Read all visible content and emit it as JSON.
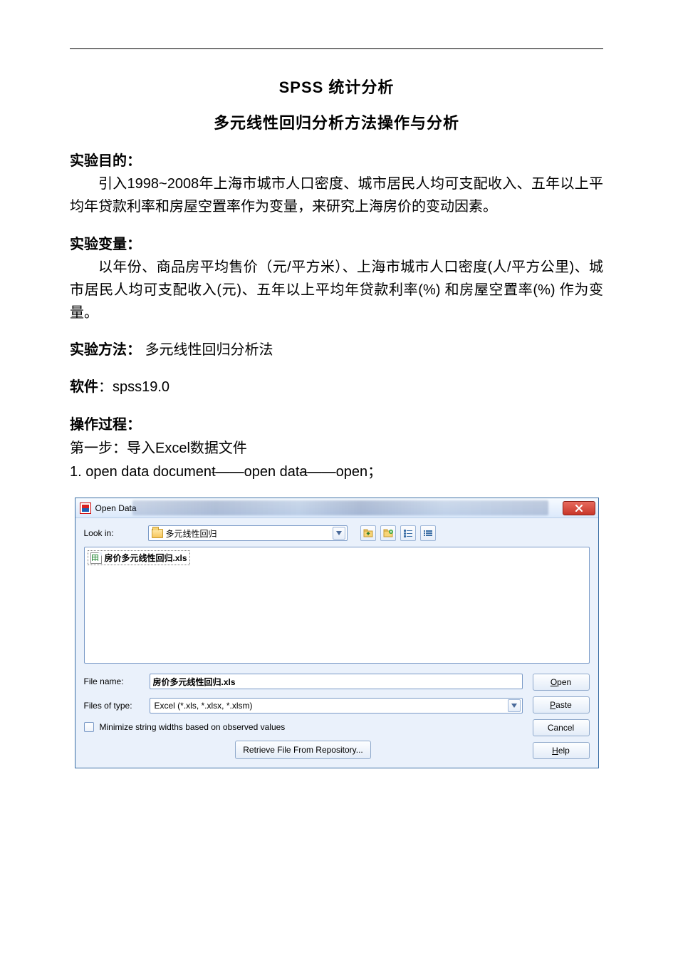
{
  "doc": {
    "title1": "SPSS  统计分析",
    "title2": "多元线性回归分析方法操作与分析",
    "sec_purpose_head": "实验目的：",
    "sec_purpose_body": "引入1998~2008年上海市城市人口密度、城市居民人均可支配收入、五年以上平均年贷款利率和房屋空置率作为变量，来研究上海房价的变动因素。",
    "sec_vars_head": "实验变量：",
    "sec_vars_body": "以年份、商品房平均售价（元/平方米）、上海市城市人口密度(人/平方公里)、城市居民人均可支配收入(元)、五年以上平均年贷款利率(%) 和房屋空置率(%) 作为变量。",
    "sec_method_head": "实验方法：",
    "sec_method_body": "多元线性回归分析法",
    "sec_soft_head": "软件",
    "sec_soft_sep": "：",
    "sec_soft_body": "spss19.0",
    "sec_proc_head": "操作过程：",
    "step1": "第一步：导入Excel数据文件",
    "step1_num": "1. ",
    "step1_a": "open data documen",
    "step1_b": "t——",
    "step1_c": "open dat",
    "step1_d": "a——",
    "step1_e": "open；"
  },
  "dialog": {
    "title": "Open Data",
    "lookin_label": "Look in:",
    "lookin_value": "多元线性回归",
    "file_item": "房价多元线性回归.xls",
    "filename_label": "File name:",
    "filename_value": "房价多元线性回归.xls",
    "filetype_label": "Files of type:",
    "filetype_value": "Excel (*.xls, *.xlsx, *.xlsm)",
    "minimize_label": "Minimize string widths based on observed values",
    "retrieve_label": "Retrieve File From Repository...",
    "buttons": {
      "open_pre": "O",
      "open_rest": "pen",
      "paste_pre": "P",
      "paste_rest": "aste",
      "cancel": "Cancel",
      "help_pre": "H",
      "help_rest": "elp"
    },
    "retrieve_pre": "R",
    "retrieve_rest": "etrieve File From Repository..."
  }
}
